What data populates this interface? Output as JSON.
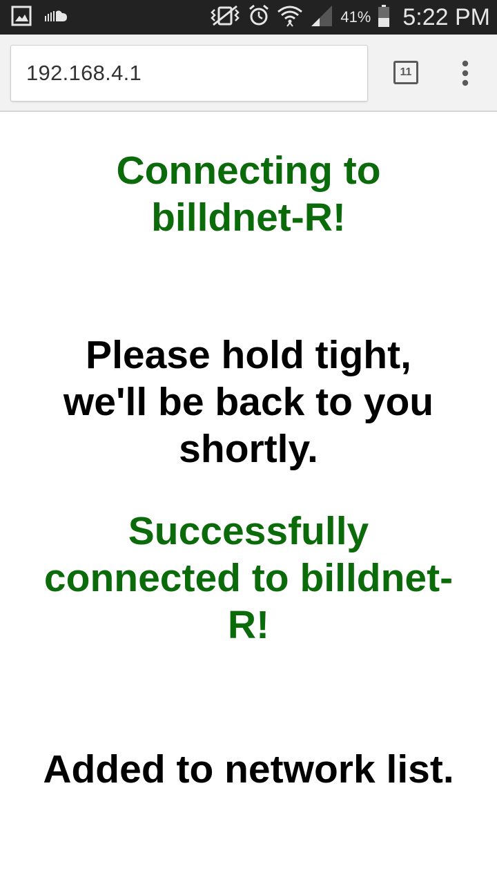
{
  "status_bar": {
    "battery_percent": "41%",
    "time": "5:22 PM",
    "icons": [
      "gallery-icon",
      "soundcloud-icon",
      "vibrate-icon",
      "alarm-icon",
      "wifi-icon",
      "signal-icon",
      "battery-icon"
    ]
  },
  "browser": {
    "url": "192.168.4.1",
    "tab_count": "11"
  },
  "page": {
    "connecting_message": "Connecting to billdnet-R!",
    "hold_message": "Please hold tight, we'll be back to you shortly.",
    "success_message": "Successfully connected to billdnet-R!",
    "added_message": "Added to network list."
  },
  "colors": {
    "success_green": "#0b6b0b",
    "status_bar_bg": "#222222",
    "toolbar_bg": "#f2f2f2"
  }
}
